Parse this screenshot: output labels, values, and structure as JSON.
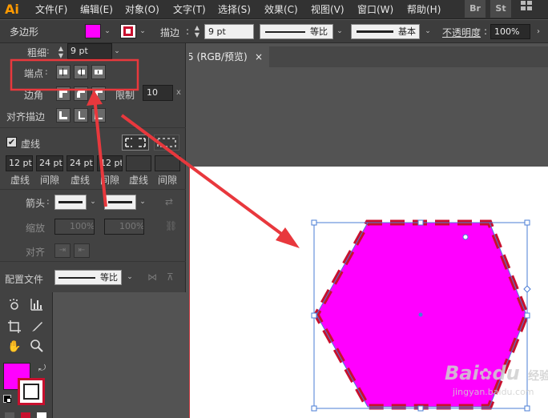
{
  "app": {
    "logo": "Ai"
  },
  "menu": [
    "文件(F)",
    "编辑(E)",
    "对象(O)",
    "文字(T)",
    "选择(S)",
    "效果(C)",
    "视图(V)",
    "窗口(W)",
    "帮助(H)"
  ],
  "menu_right": {
    "bridge": "Br",
    "stock": "St",
    "layout_icon": "grid-layout-icon"
  },
  "control_bar": {
    "object_type": "多边形",
    "fill_color": "#ff00ff",
    "stroke_swatch_color": "#c8102e",
    "stroke_label": "描边",
    "stroke_weight": "9 pt",
    "profile_label": "等比",
    "brush_label": "基本",
    "opacity_label": "不透明度",
    "opacity_value": "100%"
  },
  "stroke_panel": {
    "weight_label": "粗细",
    "weight_value": "9 pt",
    "cap_label": "端点",
    "corner_label": "边角",
    "limit_label": "限制",
    "limit_value": "10",
    "align_label": "对齐描边",
    "dashed_label": "虚线",
    "dashed_checked": true,
    "dash_values": [
      "12 pt",
      "24 pt",
      "24 pt",
      "12 pt",
      "",
      ""
    ],
    "dash_labels": [
      "虚线",
      "间隙",
      "虚线",
      "间隙",
      "虚线",
      "间隙"
    ],
    "arrow_label": "箭头",
    "scale_label": "缩放",
    "scale_values": [
      "100%",
      "100%"
    ],
    "align_arrow_label": "对齐",
    "profile_label": "配置文件",
    "profile_value": "等比"
  },
  "document_tab": {
    "title": "5 (RGB/预览)",
    "close": "×"
  },
  "canvas": {
    "shape_fill": "#ff00ff",
    "dash_color": "#c8102e",
    "highlight_color": "#e8383d",
    "arrow_color": "#e8383d"
  },
  "watermark": {
    "brand": "Bai",
    "brand2": "du",
    "cn": "经验",
    "url": "jingyan.baidu.com"
  }
}
